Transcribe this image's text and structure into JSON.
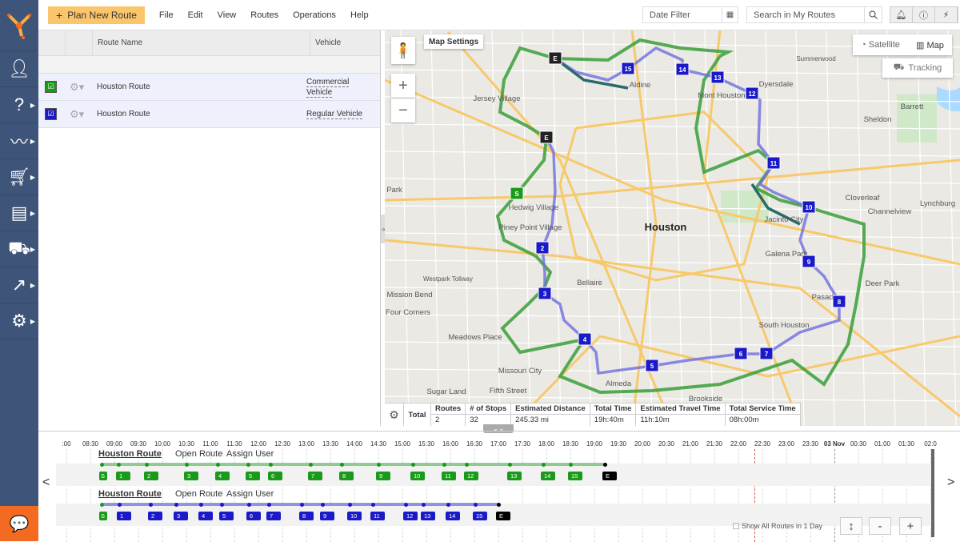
{
  "colors": {
    "sidebar": "#3f5479",
    "accent": "#fbc66b",
    "green_route": "#1a9a1a",
    "blue_route": "#1a1ac8",
    "end": "#000000",
    "chat": "#f26b21"
  },
  "sidebar": {
    "items": [
      {
        "icon": "add-driver-icon"
      },
      {
        "icon": "help-icon"
      },
      {
        "icon": "routes-icon"
      },
      {
        "icon": "orders-cart-icon"
      },
      {
        "icon": "reports-icon"
      },
      {
        "icon": "fleet-icon"
      },
      {
        "icon": "analytics-icon"
      },
      {
        "icon": "settings-user-icon"
      }
    ],
    "chat_icon": "chat-icon"
  },
  "topbar": {
    "plan_label": "Plan New Route",
    "menu": [
      "File",
      "Edit",
      "View",
      "Routes",
      "Operations",
      "Help"
    ],
    "date_filter_placeholder": "Date Filter",
    "search_placeholder": "Search in My Routes"
  },
  "routes_table": {
    "columns": [
      "Route Name",
      "Vehicle"
    ],
    "rows": [
      {
        "name": "Houston Route",
        "vehicle": "Commercial Vehicle",
        "color": "#1a9a1a",
        "checked": true
      },
      {
        "name": "Houston Route",
        "vehicle": "Regular Vehicle",
        "color": "#1a1ac8",
        "checked": true
      }
    ]
  },
  "map": {
    "settings_label": "Map Settings",
    "satellite_label": "Satellite",
    "map_label": "Map",
    "tracking_label": "Tracking",
    "zoom_in": "+",
    "zoom_out": "−",
    "places": [
      "Jersey Village",
      "Aldine",
      "Dyersdale",
      "Barrett",
      "Sheldon",
      "Houston",
      "Hedwig Village",
      "Piney Point Village",
      "Bellaire",
      "Missouri City",
      "Sugar Land",
      "Pasadena",
      "Galena Park",
      "Deer Park",
      "Channelview",
      "Cloverleaf",
      "Lynchburg",
      "South Houston",
      "Meadows Place",
      "Mission Bend",
      "Four Corners",
      "Fifth Street",
      "Brookside",
      "Almeda",
      "Park",
      "Mont Houston",
      "Jacinto City",
      "Westpark Tollway",
      "Summerwood"
    ],
    "markers": [
      "S",
      "E",
      "E",
      "2",
      "3",
      "4",
      "5",
      "6",
      "7",
      "8",
      "9",
      "10",
      "11",
      "12",
      "13",
      "14",
      "15"
    ]
  },
  "stats": {
    "total_label": "Total",
    "headers": [
      "Routes",
      "# of Stops",
      "Estimated Distance",
      "Total Time",
      "Estimated Travel Time",
      "Total Service Time"
    ],
    "values": [
      "2",
      "32",
      "245.33 mi",
      "19h:40m",
      "11h:10m",
      "08h:00m"
    ]
  },
  "timeline": {
    "ticks": [
      ":00",
      "08:30",
      "09:00",
      "09:30",
      "10:00",
      "10:30",
      "11:00",
      "11:30",
      "12:00",
      "12:30",
      "13:00",
      "13:30",
      "14:00",
      "14:30",
      "15:00",
      "15:30",
      "16:00",
      "16:30",
      "17:00",
      "17:30",
      "18:00",
      "18:30",
      "19:00",
      "19:30",
      "20:00",
      "20:30",
      "21:00",
      "21:30",
      "22:00",
      "22:30",
      "23:00",
      "23:30",
      "03 Nov",
      "00:30",
      "01:00",
      "01:30",
      "02:0"
    ],
    "current_time": "22:20",
    "routes": [
      {
        "name": "Houston Route",
        "open": "Open Route",
        "assign": "Assign User",
        "color": "#1a9a1a",
        "stops": [
          [
            "S",
            "08:44"
          ],
          [
            "1",
            "09:05"
          ],
          [
            "2",
            "09:40"
          ],
          [
            "3",
            "10:30"
          ],
          [
            "4",
            "11:09"
          ],
          [
            "5",
            "11:47"
          ],
          [
            "6",
            "12:15"
          ],
          [
            "7",
            "13:05"
          ],
          [
            "8",
            "13:44"
          ],
          [
            "9",
            "14:30"
          ],
          [
            "10",
            "15:13"
          ],
          [
            "11",
            "15:52"
          ],
          [
            "12",
            "16:20"
          ],
          [
            "13",
            "17:14"
          ],
          [
            "14",
            "17:56"
          ],
          [
            "15",
            "18:30"
          ],
          [
            "E",
            "19:13"
          ]
        ]
      },
      {
        "name": "Houston Route",
        "open": "Open Route",
        "assign": "Assign User",
        "color": "#1a1ac8",
        "stops": [
          [
            "S",
            "08:44"
          ],
          [
            "1",
            "09:06"
          ],
          [
            "2",
            "09:45"
          ],
          [
            "3",
            "10:17"
          ],
          [
            "4",
            "10:48"
          ],
          [
            "5",
            "11:14"
          ],
          [
            "6",
            "11:48"
          ],
          [
            "7",
            "12:13"
          ],
          [
            "8",
            "12:54"
          ],
          [
            "9",
            "13:20"
          ],
          [
            "10",
            "13:54"
          ],
          [
            "11",
            "14:23"
          ],
          [
            "12",
            "15:04"
          ],
          [
            "13",
            "15:26"
          ],
          [
            "14",
            "15:57"
          ],
          [
            "15",
            "16:31"
          ],
          [
            "E",
            "17:00"
          ]
        ]
      }
    ],
    "show_all_label": "Show All Routes in 1 Day",
    "prev": "<",
    "next": ">",
    "minus": "-",
    "plus": "+"
  }
}
